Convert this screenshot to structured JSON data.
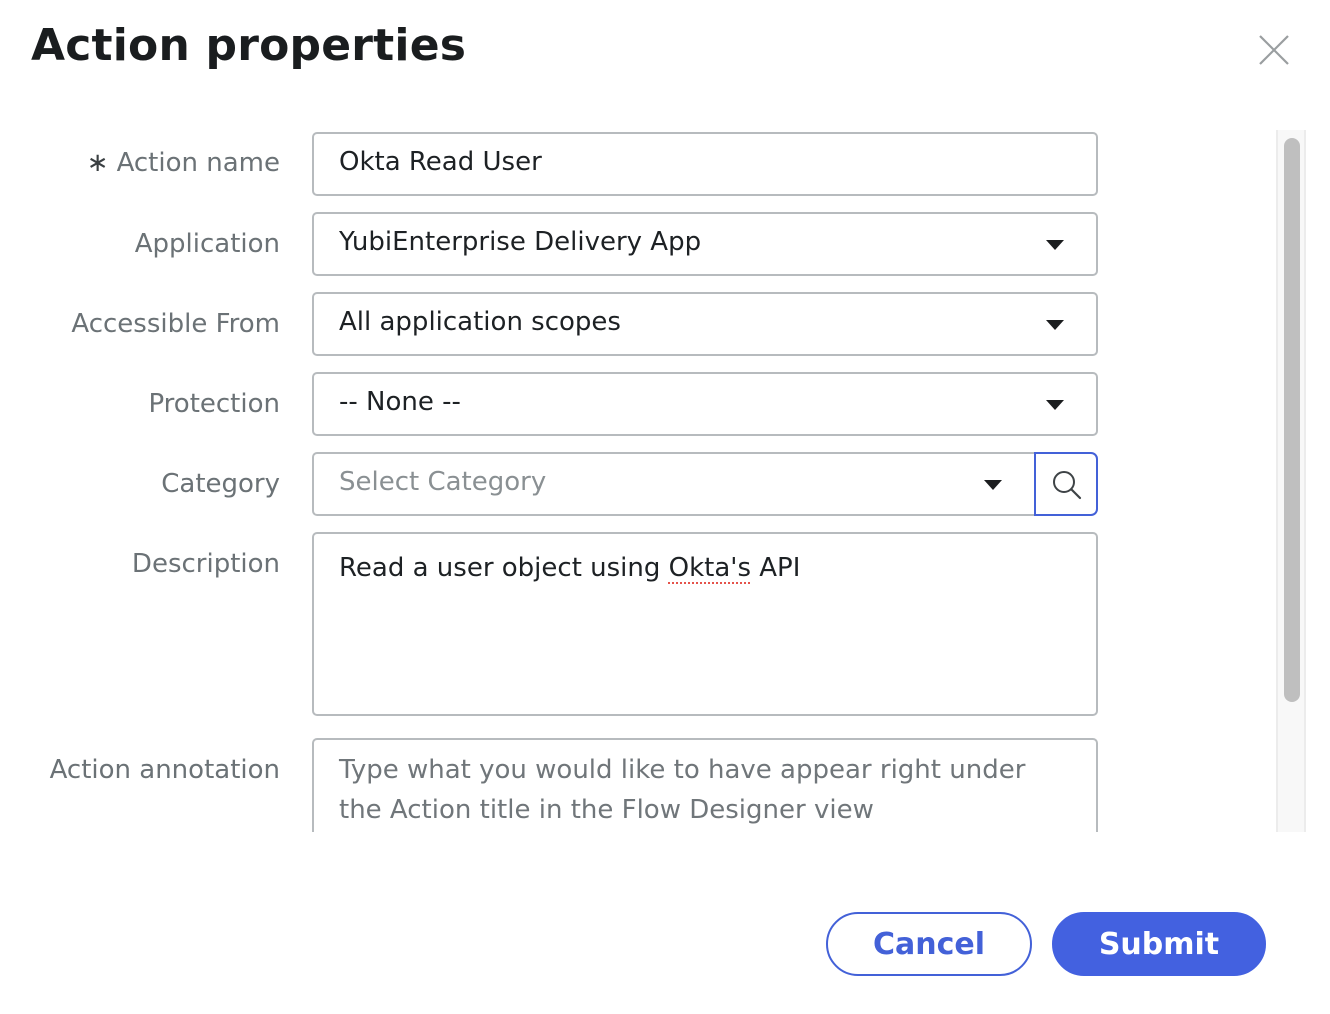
{
  "dialog": {
    "title": "Action properties",
    "close_icon": "close-icon"
  },
  "form": {
    "action_name": {
      "label": "Action name",
      "required_marker": "∗",
      "value": "Okta Read User"
    },
    "application": {
      "label": "Application",
      "value": "YubiEnterprise Delivery App",
      "icon": "caret-down-icon"
    },
    "accessible_from": {
      "label": "Accessible From",
      "value": "All application scopes",
      "icon": "caret-down-icon"
    },
    "protection": {
      "label": "Protection",
      "value": "-- None --",
      "icon": "caret-down-icon"
    },
    "category": {
      "label": "Category",
      "placeholder": "Select Category",
      "value": "",
      "icon": "caret-down-icon",
      "search_icon": "search-icon"
    },
    "description": {
      "label": "Description",
      "value_before": "Read a user object using ",
      "value_misspelled": "Okta's",
      "value_after": " API"
    },
    "action_annotation": {
      "label": "Action annotation",
      "placeholder": "Type what you would like to have appear right under the Action title in the Flow Designer view",
      "value": ""
    }
  },
  "footer": {
    "cancel_label": "Cancel",
    "submit_label": "Submit"
  },
  "colors": {
    "accent": "#4361d8",
    "title": "#1a1d1f",
    "label": "#6b7276",
    "border": "#b7bbbe"
  }
}
